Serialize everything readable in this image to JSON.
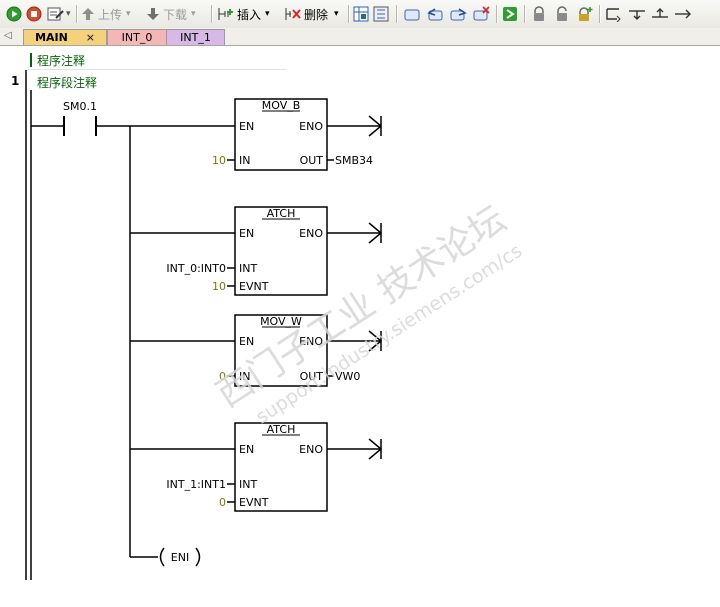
{
  "toolbar": {
    "upload_label": "上传",
    "download_label": "下载",
    "insert_label": "插入",
    "delete_label": "删除"
  },
  "tabs": [
    {
      "label": "MAIN",
      "close": "×",
      "color": "#f5d27a"
    },
    {
      "label": "INT_0",
      "color": "#f4b6b6"
    },
    {
      "label": "INT_1",
      "color": "#d7b9e8"
    }
  ],
  "program": {
    "program_comment": "程序注释",
    "network_number": "1",
    "network_comment": "程序段注释",
    "contact": "SM0.1",
    "blocks": [
      {
        "name": "MOV_B",
        "en": "EN",
        "eno": "ENO",
        "in_pins": [
          {
            "pin": "IN",
            "value": "10"
          }
        ],
        "out_pin": "OUT",
        "out_value": "SMB34"
      },
      {
        "name": "ATCH",
        "en": "EN",
        "eno": "ENO",
        "in_pins": [
          {
            "pin": "INT",
            "value": "INT_0:INT0"
          },
          {
            "pin": "EVNT",
            "value": "10"
          }
        ]
      },
      {
        "name": "MOV_W",
        "en": "EN",
        "eno": "ENO",
        "in_pins": [
          {
            "pin": "IN",
            "value": "0"
          }
        ],
        "out_pin": "OUT",
        "out_value": "VW0"
      },
      {
        "name": "ATCH",
        "en": "EN",
        "eno": "ENO",
        "in_pins": [
          {
            "pin": "INT",
            "value": "INT_1:INT1"
          },
          {
            "pin": "EVNT",
            "value": "0"
          }
        ]
      }
    ],
    "coil": "ENI"
  },
  "watermark": {
    "line1": "西门子工业 技术论坛",
    "line2": "support.industry.siemens.com/cs"
  },
  "colors": {
    "comment_green": "#006400",
    "constant_olive": "#7a7a00",
    "rail": "#000000"
  }
}
